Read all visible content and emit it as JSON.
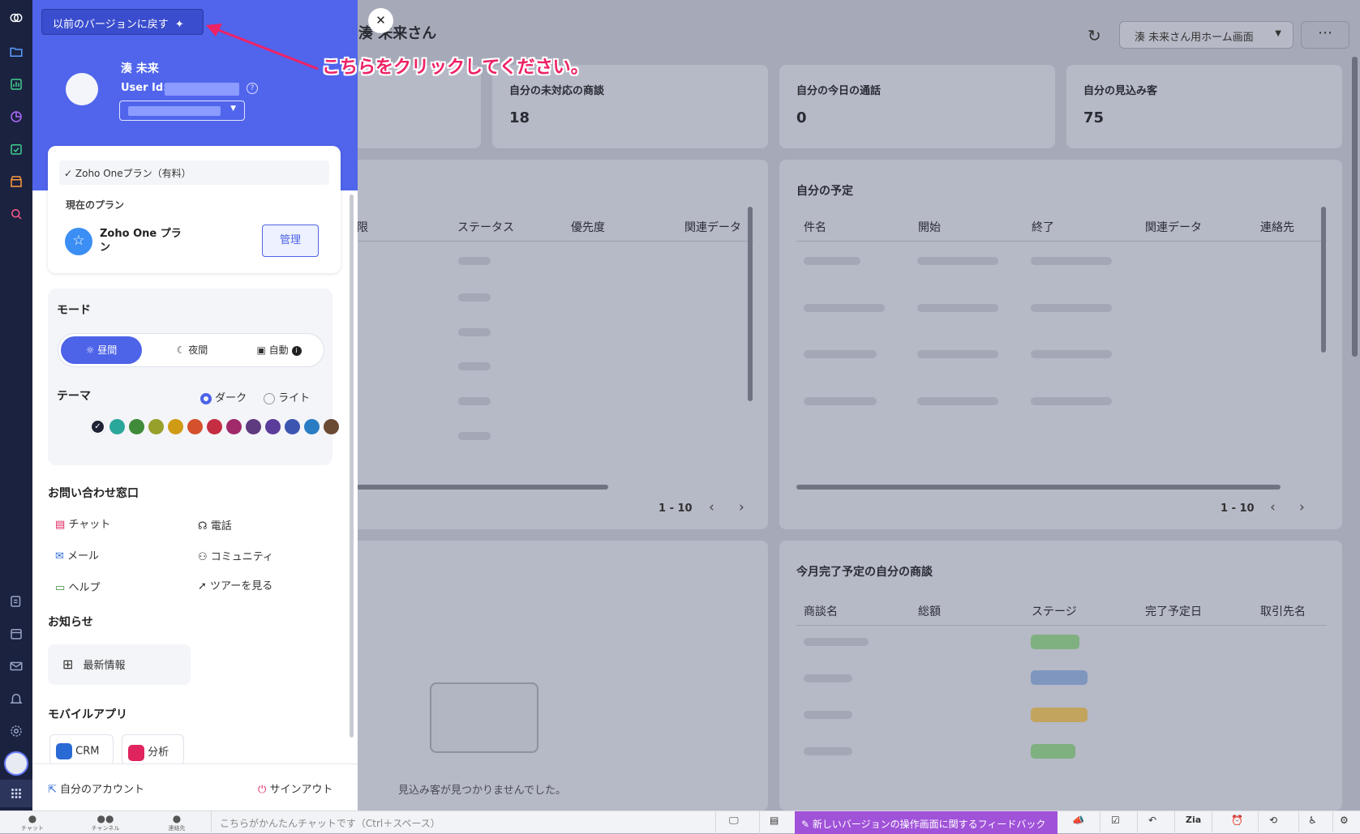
{
  "main": {
    "greeting": "、湊 未来さん",
    "home_select": "湊 未来さん用ホーム画面",
    "kpis": [
      {
        "label": "自分の未対応の商談",
        "value": "18"
      },
      {
        "label": "自分の今日の通話",
        "value": "0"
      },
      {
        "label": "自分の見込み客",
        "value": "75"
      }
    ],
    "tasks_table": {
      "headers": [
        "限",
        "ステータス",
        "優先度",
        "関連データ"
      ],
      "pager": "1 - 10"
    },
    "schedule": {
      "title": "自分の予定",
      "headers": [
        "件名",
        "開始",
        "終了",
        "関連データ",
        "連絡先"
      ],
      "pager": "1 - 10"
    },
    "leads_empty": "見込み客が見つかりませんでした。",
    "deals": {
      "title": "今月完了予定の自分の商談",
      "headers": [
        "商談名",
        "総額",
        "ステージ",
        "完了予定日",
        "取引先名"
      ]
    }
  },
  "panel": {
    "revert_button": "以前のバージョンに戻す",
    "user_name": "湊 未来",
    "user_id_label": "User Id:",
    "plan_badge": "Zoho Oneプラン（有料）",
    "current_plan_label": "現在のプラン",
    "plan_name": "Zoho One プラン",
    "manage_button": "管理",
    "mode_title": "モード",
    "mode_day": "昼間",
    "mode_night": "夜間",
    "mode_auto": "自動",
    "theme_title": "テーマ",
    "theme_dark": "ダーク",
    "theme_light": "ライト",
    "theme_colors": [
      "#1d2335",
      "#2aa79b",
      "#3f8b3a",
      "#96a02a",
      "#cf9b14",
      "#d4512c",
      "#c52d42",
      "#a02a6a",
      "#5e3a7e",
      "#5a3d9a",
      "#3b55b0",
      "#2a7cc4",
      "#6a4a33"
    ],
    "contact_title": "お問い合わせ窓口",
    "contact": {
      "chat": "チャット",
      "phone": "電話",
      "mail": "メール",
      "community": "コミュニティ",
      "help": "ヘルプ",
      "tour": "ツアーを見る"
    },
    "news_title": "お知らせ",
    "news_item": "最新情報",
    "mobile_title": "モバイルアプリ",
    "mobile_crm": "CRM",
    "mobile_analytics": "分析",
    "my_account": "自分のアカウント",
    "sign_out": "サインアウト"
  },
  "annotation": "こちらをクリックしてください。",
  "footer": {
    "chat": "チャット",
    "channel": "チャンネル",
    "contacts": "連絡先",
    "chat_placeholder": "こちらがかんたんチャットです（Ctrl＋スペース）",
    "feedback": "新しいバージョンの操作画面に関するフィードバック"
  }
}
